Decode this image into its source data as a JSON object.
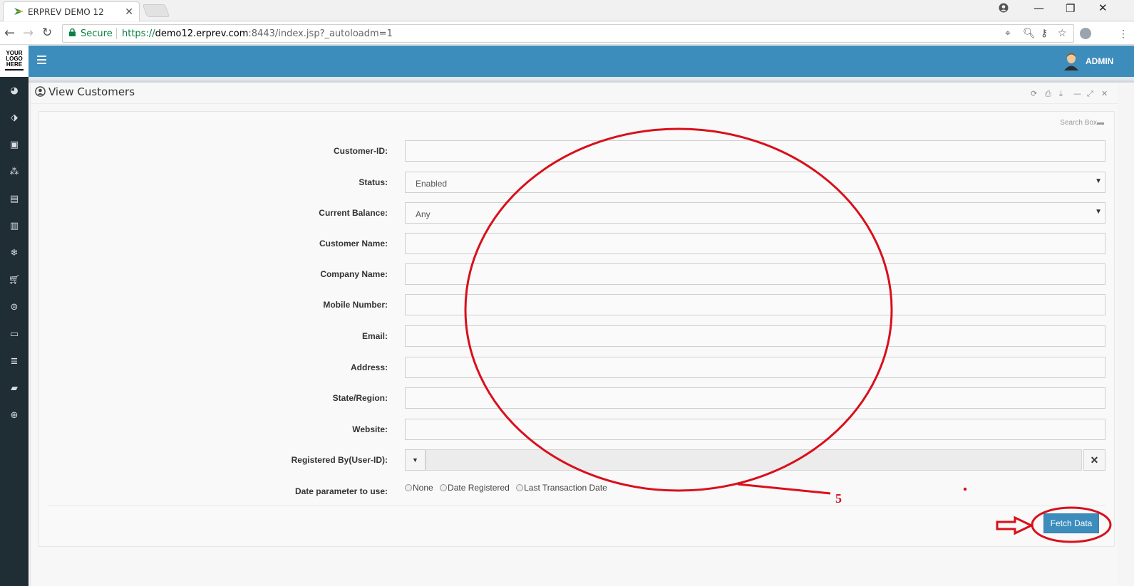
{
  "browser": {
    "tab_title": "ERPREV DEMO 12",
    "tab_close": "✕",
    "secure_label": "Secure",
    "url_scheme": "https://",
    "url_host": "demo12.erprev.com",
    "url_rest": ":8443/index.jsp?_autoloadm=1"
  },
  "app": {
    "logo_lines": [
      "YOUR",
      "LOGO",
      "HERE"
    ],
    "user_label": "ADMIN",
    "brand_color": "#3c8dbc",
    "sidebar_color": "#1f2d34"
  },
  "panel": {
    "title": "View Customers",
    "search_box_label": "Search Box"
  },
  "form": {
    "customer_id": {
      "label": "Customer-ID:",
      "value": ""
    },
    "status": {
      "label": "Status:",
      "value": "Enabled"
    },
    "current_balance": {
      "label": "Current Balance:",
      "value": "Any"
    },
    "customer_name": {
      "label": "Customer Name:",
      "value": ""
    },
    "company_name": {
      "label": "Company Name:",
      "value": ""
    },
    "mobile_number": {
      "label": "Mobile Number:",
      "value": ""
    },
    "email": {
      "label": "Email:",
      "value": ""
    },
    "address": {
      "label": "Address:",
      "value": ""
    },
    "state_region": {
      "label": "State/Region:",
      "value": ""
    },
    "website": {
      "label": "Website:",
      "value": ""
    },
    "registered_by": {
      "label": "Registered By(User-ID):",
      "value": ""
    },
    "date_parameter": {
      "label": "Date parameter to use:",
      "options": [
        "None",
        "Date Registered",
        "Last Transaction Date"
      ]
    }
  },
  "actions": {
    "fetch_label": "Fetch Data"
  },
  "annotation": {
    "number": "5",
    "color": "#d8101b"
  }
}
